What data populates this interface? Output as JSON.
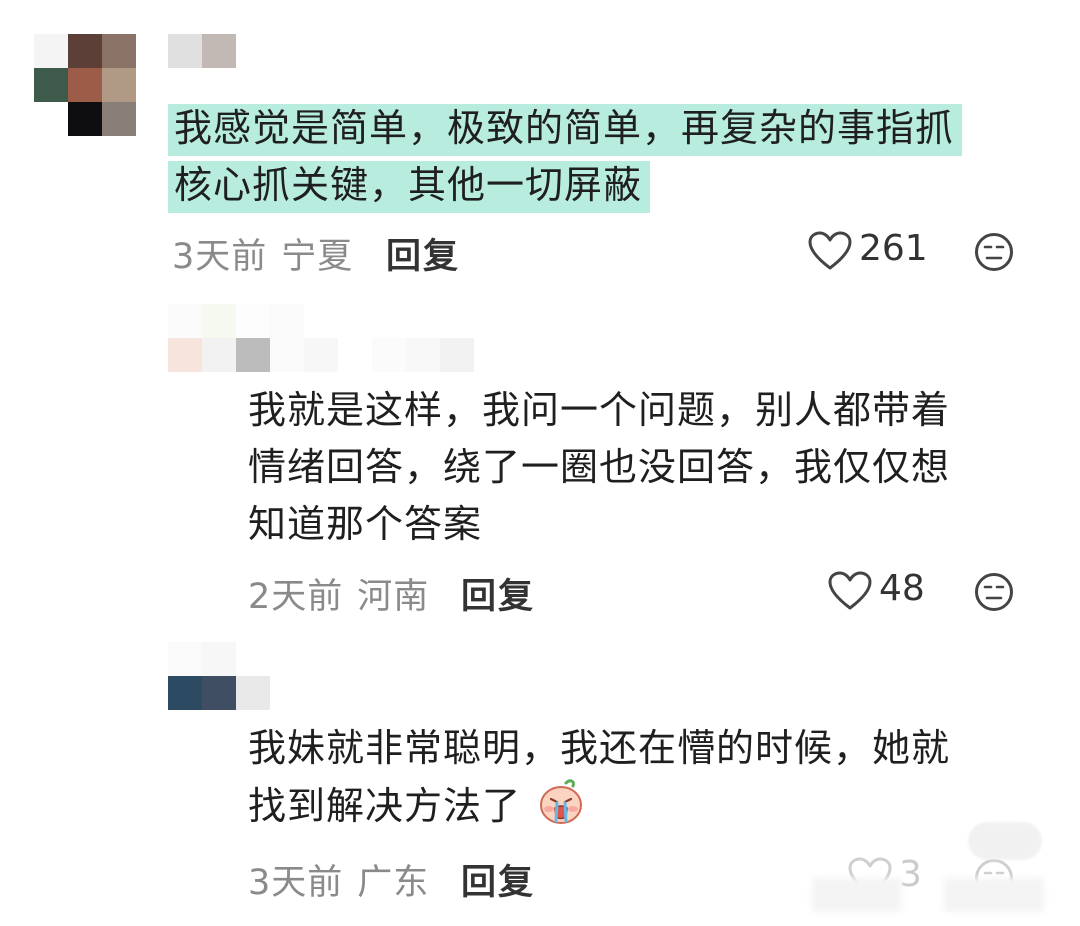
{
  "comments": [
    {
      "lines": [
        "我感觉是简单，极致的简单，再复杂的事指抓",
        "核心抓关键，其他一切屏蔽"
      ],
      "time": "3天前",
      "location": "宁夏",
      "reply_label": "回复",
      "likes": "261",
      "highlight_color": "#b8ecdf"
    },
    {
      "lines": [
        "我就是这样，我问一个问题，别人都带着",
        "情绪回答，绕了一圈也没回答，我仅仅想",
        "知道那个答案"
      ],
      "time": "2天前",
      "location": "河南",
      "reply_label": "回复",
      "likes": "48"
    },
    {
      "lines": [
        "我妹就非常聪明，我还在懵的时候，她就",
        "找到解决方法了"
      ],
      "emoji": "crying-face-emoji",
      "time": "3天前",
      "location": "广东",
      "reply_label": "回复",
      "likes": "3"
    }
  ],
  "icons": {
    "like": "heart-outline-icon",
    "dislike": "neutral-face-icon"
  },
  "colors": {
    "meta_text": "#8a8a8a",
    "reply_text": "#333333",
    "highlight": "#b8ecdf"
  }
}
